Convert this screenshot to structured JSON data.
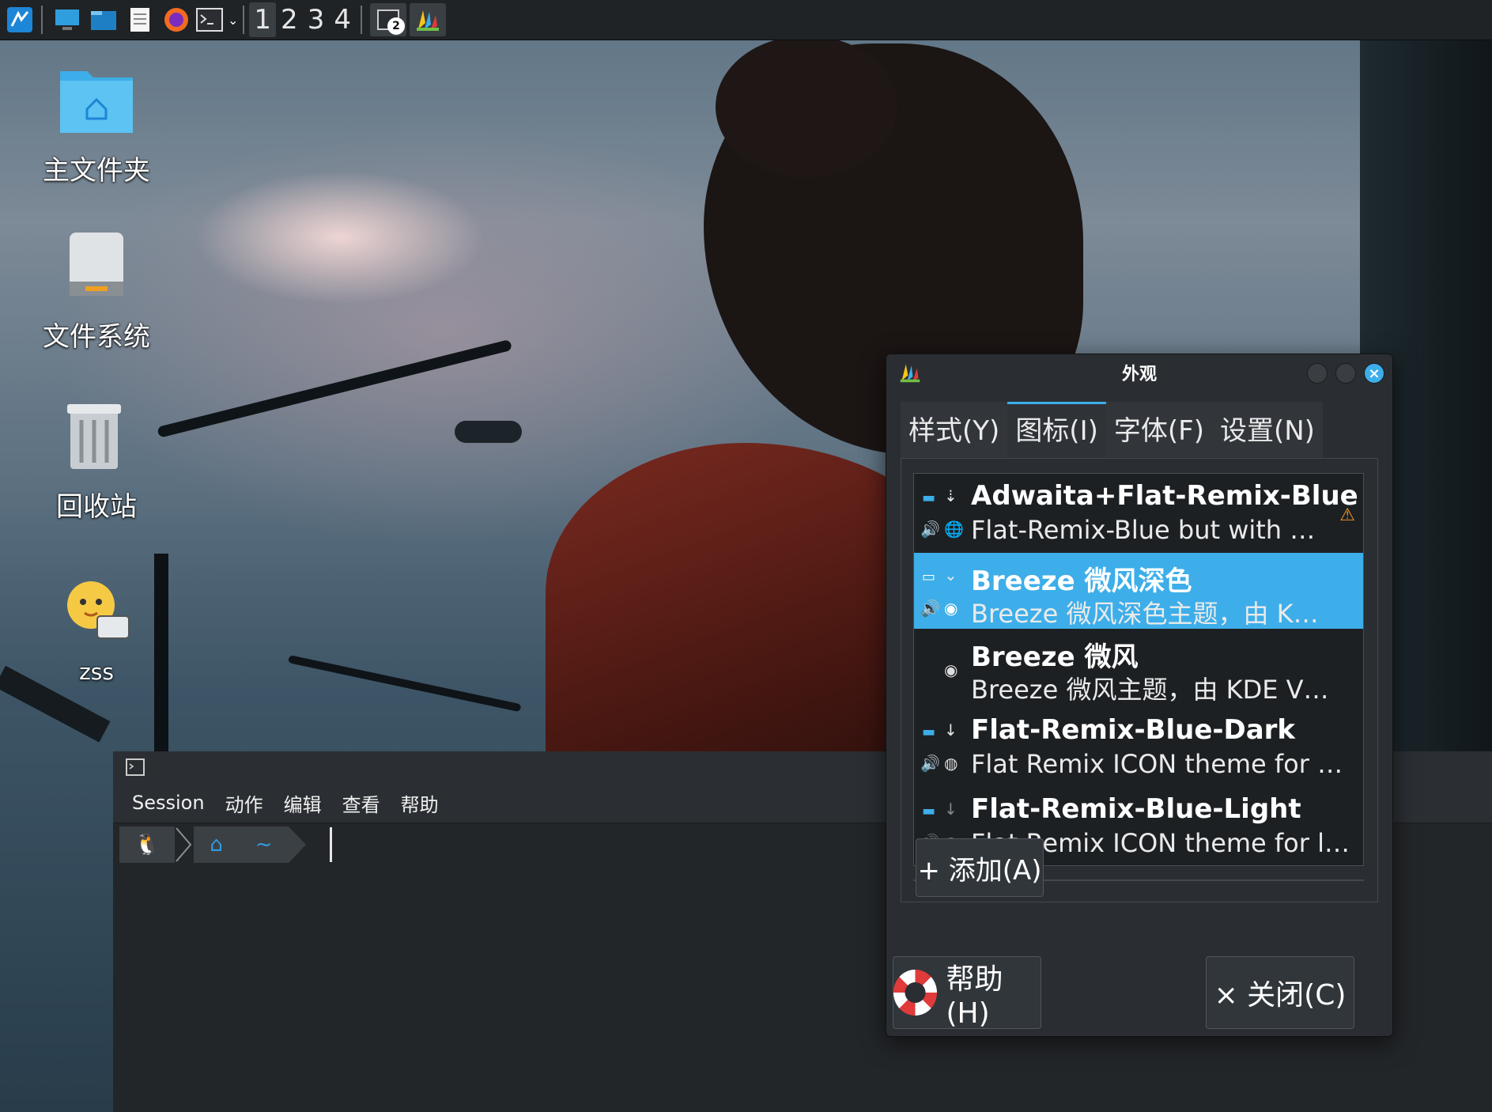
{
  "taskbar": {
    "launcher_icon": "kde-menu-icon",
    "apps": [
      "desktop-icon",
      "file-manager-icon",
      "text-editor-icon",
      "firefox-icon",
      "terminal-icon"
    ],
    "pager": [
      "1",
      "2",
      "3",
      "4"
    ],
    "active_desktop": "1",
    "task_badge": "2"
  },
  "desktop": {
    "icons": [
      {
        "label": "主文件夹",
        "icon": "home-folder-icon"
      },
      {
        "label": "文件系统",
        "icon": "drive-icon"
      },
      {
        "label": "回收站",
        "icon": "trash-icon"
      },
      {
        "label": "zss",
        "icon": "user-avatar-icon"
      }
    ]
  },
  "konsole": {
    "menu": [
      "Session",
      "动作",
      "编辑",
      "查看",
      "帮助"
    ],
    "prompt_home": "⌂",
    "prompt_path": "~"
  },
  "dialog": {
    "title": "外观",
    "tabs": [
      "样式(Y)",
      "图标(I)",
      "字体(F)",
      "设置(N)"
    ],
    "active_tab": "图标(I)",
    "themes": [
      {
        "name": "Adwaita+Flat-Remix-Blue",
        "desc": "Flat-Remix-Blue but with …",
        "warning": "⚠"
      },
      {
        "name": "Breeze 微风深色",
        "desc": "Breeze 微风深色主题，由 K…",
        "selected": true
      },
      {
        "name": "Breeze 微风",
        "desc": "Breeze 微风主题，由 KDE V…"
      },
      {
        "name": "Flat-Remix-Blue-Dark",
        "desc": "Flat Remix ICON theme for …"
      },
      {
        "name": "Flat-Remix-Blue-Light",
        "desc": "Flat Remix ICON theme for l…"
      }
    ],
    "add_button": "+ 添加(A)",
    "help_button": "帮助(H)",
    "close_button": "× 关闭(C)",
    "accent_color": "#3daee9"
  }
}
